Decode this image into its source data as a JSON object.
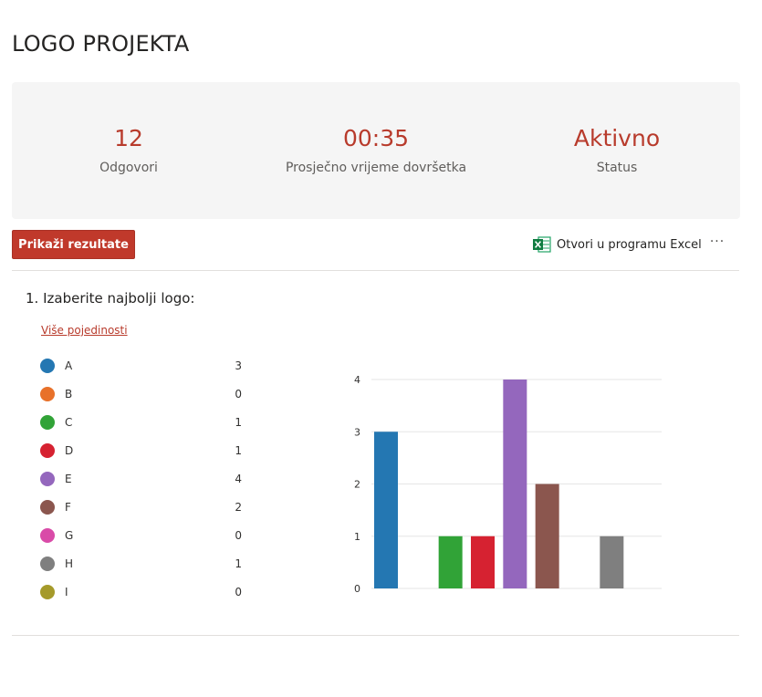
{
  "page": {
    "title": "LOGO PROJEKTA"
  },
  "summary": {
    "responses": {
      "value": "12",
      "label": "Odgovori"
    },
    "avg_time": {
      "value": "00:35",
      "label": "Prosječno vrijeme dovršetka"
    },
    "status": {
      "value": "Aktivno",
      "label": "Status"
    }
  },
  "toolbar": {
    "show_results_label": "Prikaži rezultate",
    "open_excel_label": "Otvori u programu Excel",
    "more_label": "···"
  },
  "question": {
    "number_title": "1.  Izaberite najbolji logo:",
    "more_details": "Više pojedinosti"
  },
  "options": [
    {
      "label": "A",
      "count": "3",
      "color": "#2477b2"
    },
    {
      "label": "B",
      "count": "0",
      "color": "#e8712a"
    },
    {
      "label": "C",
      "count": "1",
      "color": "#31a337"
    },
    {
      "label": "D",
      "count": "1",
      "color": "#d62231"
    },
    {
      "label": "E",
      "count": "4",
      "color": "#9467bd"
    },
    {
      "label": "F",
      "count": "2",
      "color": "#8b564e"
    },
    {
      "label": "G",
      "count": "0",
      "color": "#d94ba8"
    },
    {
      "label": "H",
      "count": "1",
      "color": "#7f7f7f"
    },
    {
      "label": "I",
      "count": "0",
      "color": "#a59a2a"
    }
  ],
  "chart_data": {
    "type": "bar",
    "categories": [
      "A",
      "B",
      "C",
      "D",
      "E",
      "F",
      "G",
      "H",
      "I"
    ],
    "values": [
      3,
      0,
      1,
      1,
      4,
      2,
      0,
      1,
      0
    ],
    "colors": [
      "#2477b2",
      "#e8712a",
      "#31a337",
      "#d62231",
      "#9467bd",
      "#8b564e",
      "#d94ba8",
      "#7f7f7f",
      "#a59a2a"
    ],
    "ylim": [
      0,
      4
    ],
    "yticks": [
      "0",
      "1",
      "2",
      "3",
      "4"
    ],
    "grid": true,
    "title": "",
    "xlabel": "",
    "ylabel": ""
  }
}
